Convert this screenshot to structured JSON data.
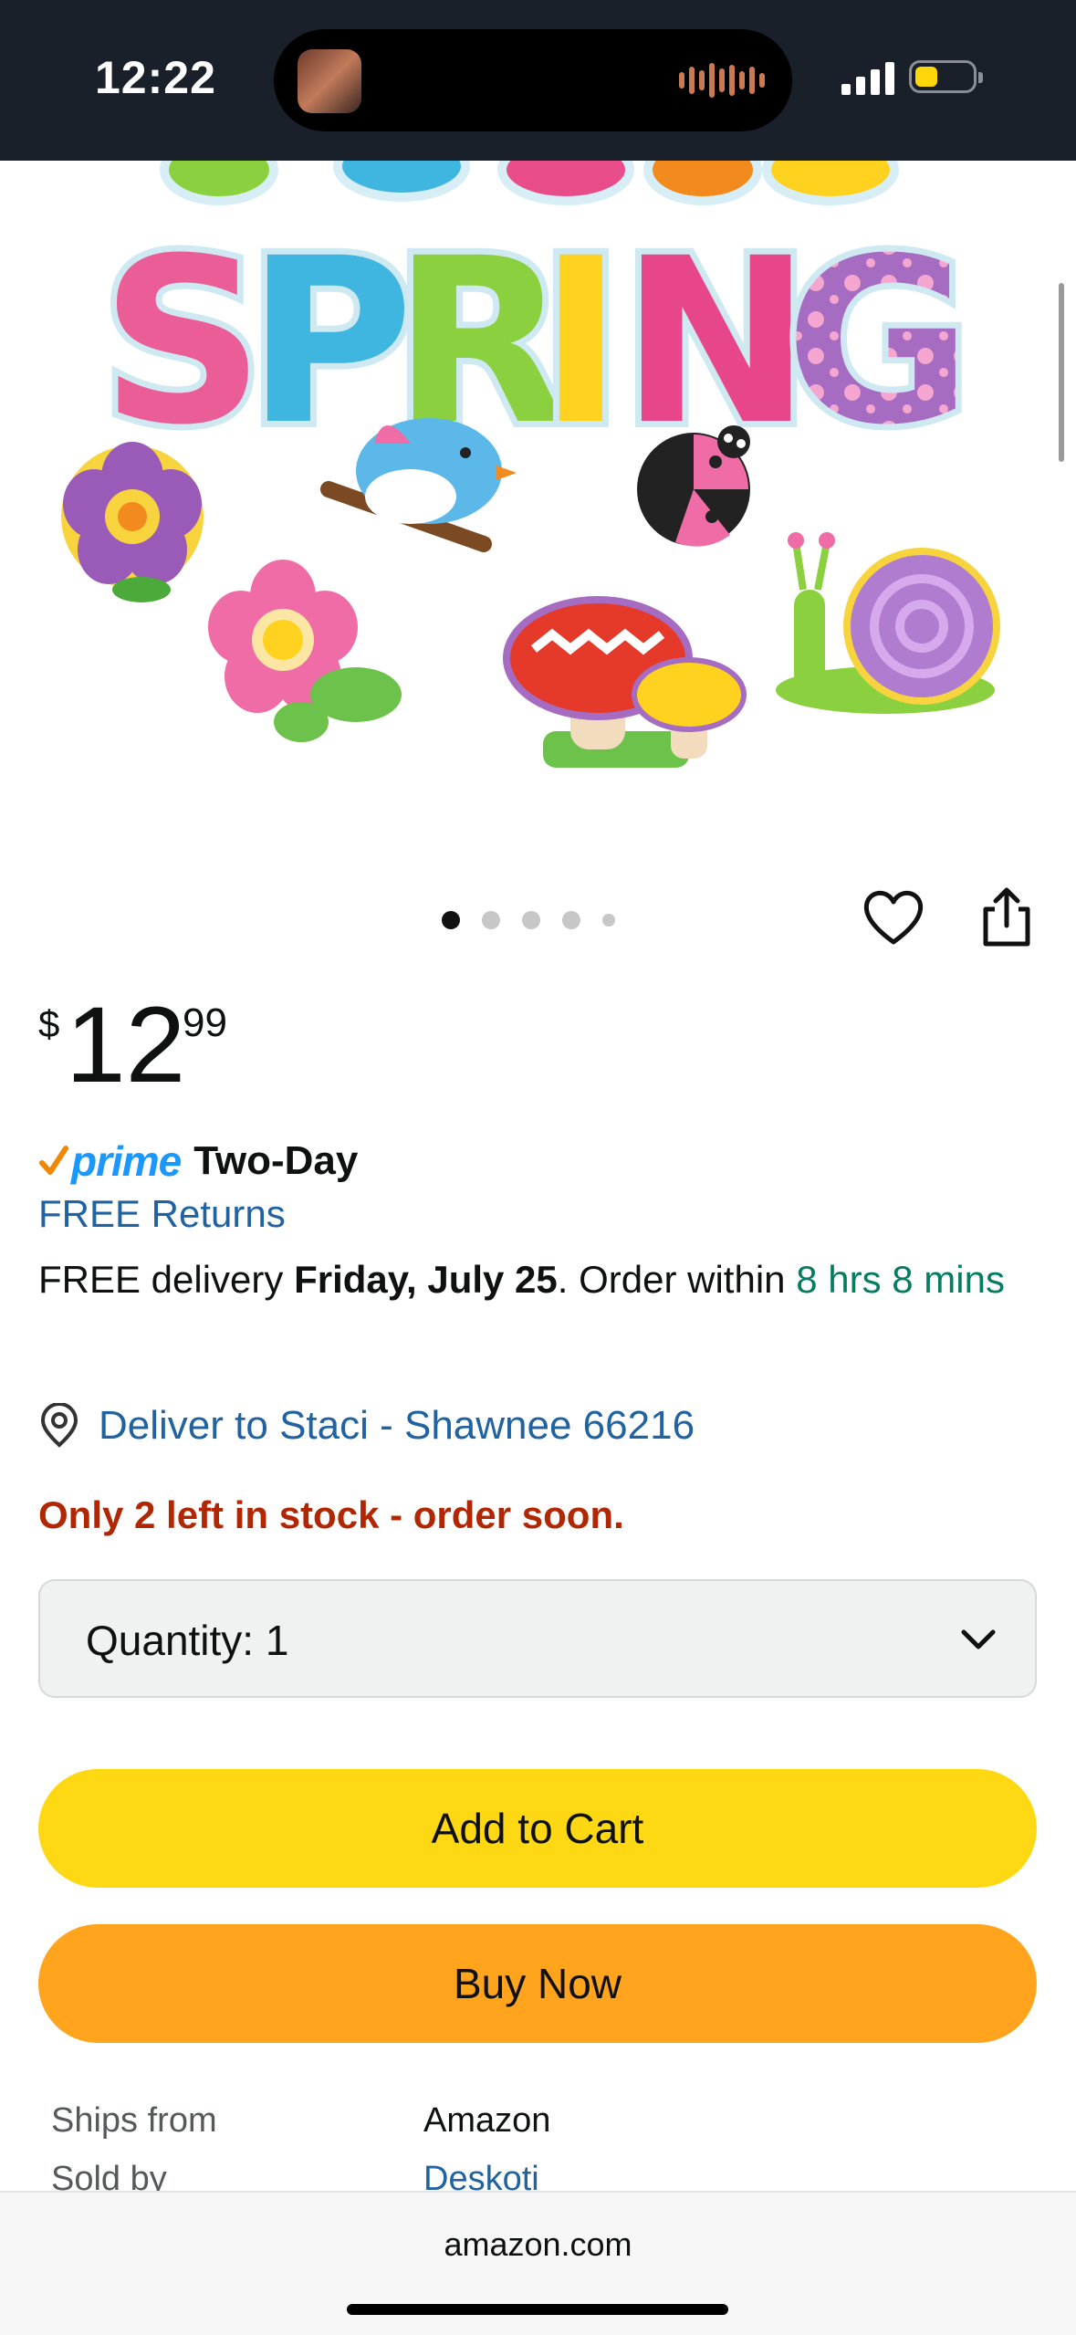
{
  "status_bar": {
    "time": "12:22"
  },
  "product_image": {
    "title_text": "SPRING",
    "description": "spring decoration cutouts"
  },
  "carousel": {
    "total": 5,
    "active_index": 0
  },
  "price": {
    "symbol": "$",
    "whole": "12",
    "fraction": "99"
  },
  "prime": {
    "logo": "prime",
    "badge": "Two-Day"
  },
  "returns": "FREE Returns",
  "delivery": {
    "prefix": "FREE delivery ",
    "date": "Friday, July 25",
    "mid": ". Order within ",
    "countdown": "8 hrs 8 mins"
  },
  "deliver_to": "Deliver to Staci - Shawnee 66216",
  "stock_warning": "Only 2 left in stock - order soon.",
  "quantity": {
    "label": "Quantity:",
    "value": "1"
  },
  "buttons": {
    "add_to_cart": "Add to Cart",
    "buy_now": "Buy Now"
  },
  "seller_info": [
    {
      "label": "Ships from",
      "value": "Amazon"
    },
    {
      "label": "Sold by",
      "value": "Deskoti"
    }
  ],
  "browser": {
    "url": "amazon.com"
  },
  "colors": {
    "add_to_cart": "#ffd814",
    "buy_now": "#ffa41c",
    "link": "#2162a1",
    "stock": "#b12704",
    "countdown": "#067d62",
    "prime": "#1a98ff"
  }
}
